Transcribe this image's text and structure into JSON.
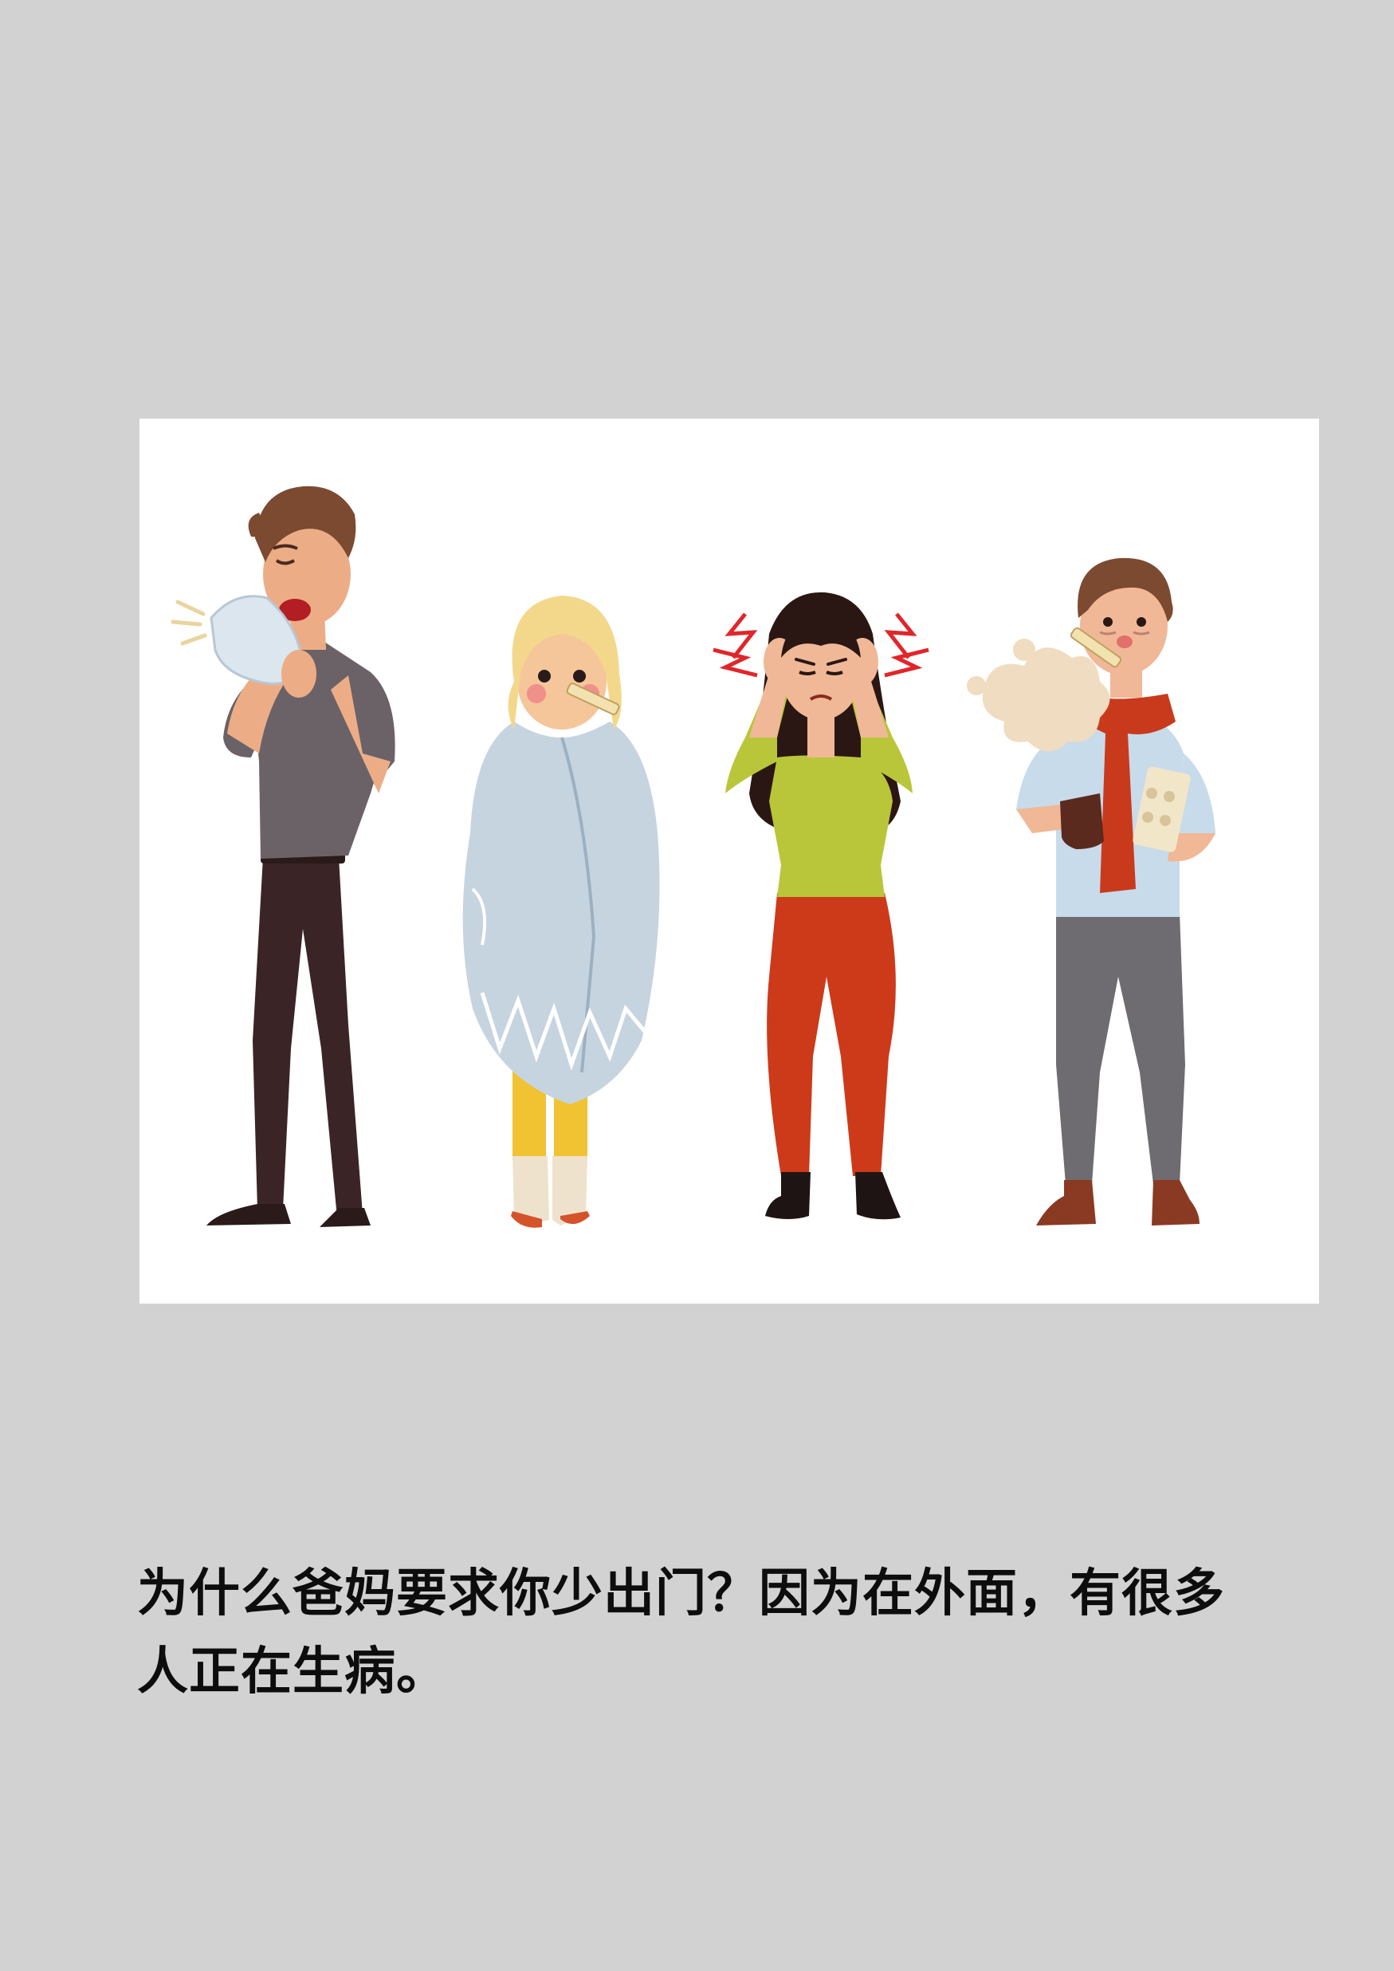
{
  "illustration": {
    "figures": [
      {
        "icon": "sneezing-man-icon"
      },
      {
        "icon": "child-in-blanket-icon"
      },
      {
        "icon": "woman-with-headache-icon"
      },
      {
        "icon": "man-with-thermometer-icon"
      }
    ],
    "colors": {
      "panel": "#ffffff",
      "page": "#d3d2d3"
    }
  },
  "caption": {
    "line1": "为什么爸妈要求你少出门？因为在外面，有很多",
    "line2": "人正在生病。"
  }
}
